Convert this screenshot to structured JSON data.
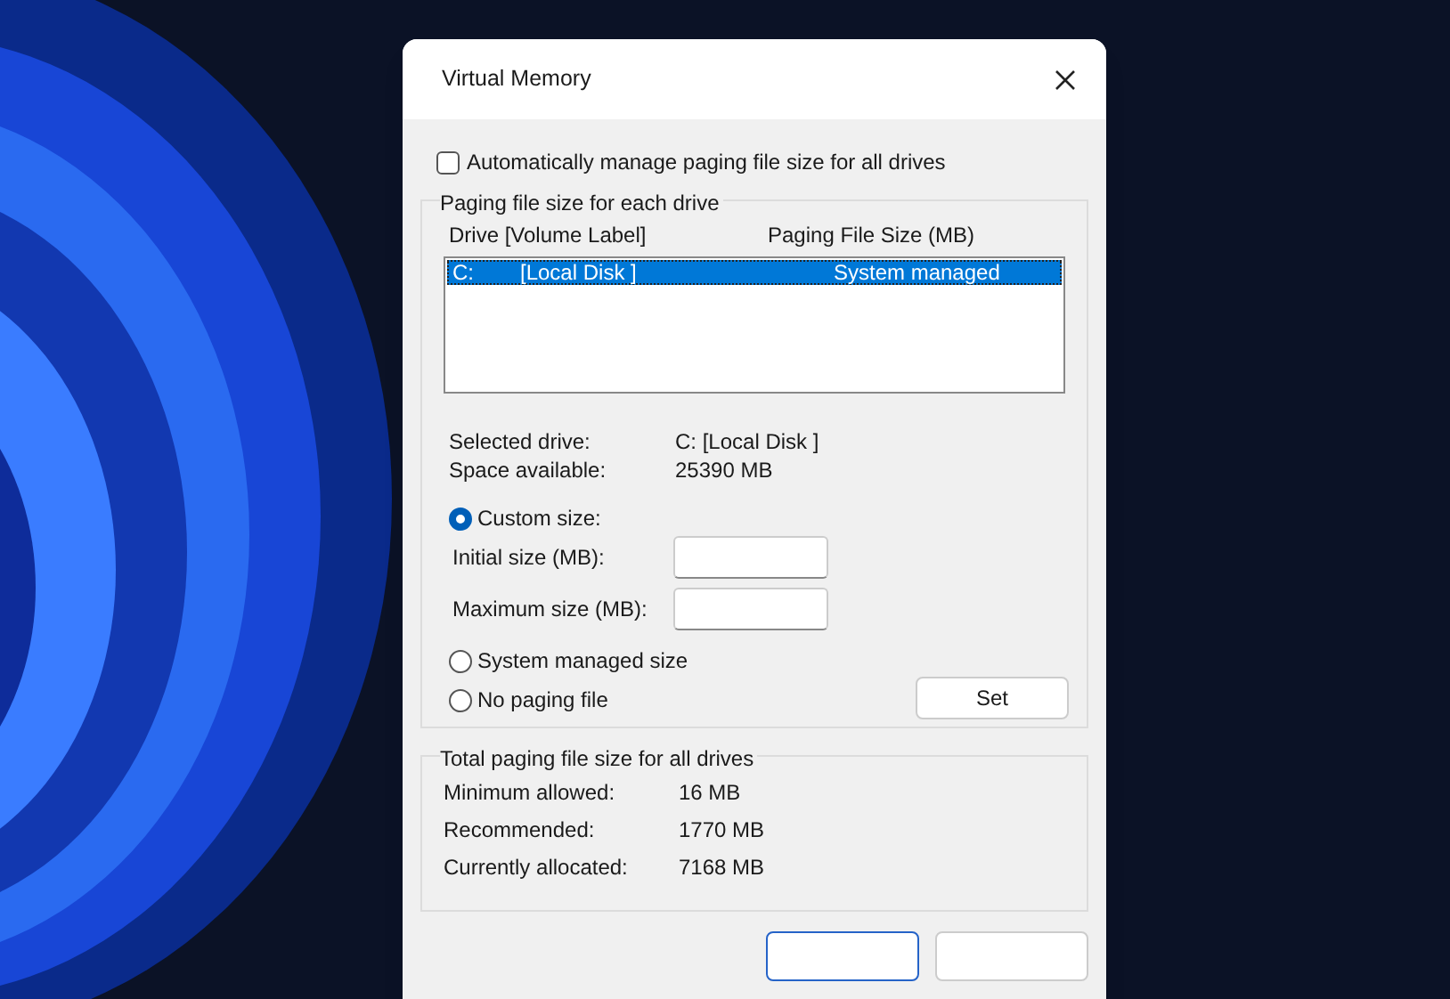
{
  "window": {
    "title": "Virtual Memory"
  },
  "auto_manage": {
    "label": "Automatically manage paging file size for all drives",
    "checked": false
  },
  "drive_group": {
    "title": "Paging file size for each drive",
    "columns": [
      "Drive  [Volume Label]",
      "Paging File Size (MB)"
    ],
    "rows": [
      {
        "drive": "C:",
        "volume": "[Local Disk ]",
        "size": "System managed",
        "selected": true
      }
    ],
    "selected_drive": {
      "label": "Selected drive:",
      "value": "C:  [Local Disk ]"
    },
    "space_available": {
      "label": "Space available:",
      "value": "25390 MB"
    },
    "options": [
      {
        "kind": "custom",
        "label": "Custom size:",
        "selected": true
      },
      {
        "kind": "system",
        "label": "System managed size",
        "selected": false
      },
      {
        "kind": "none",
        "label": "No paging file",
        "selected": false
      }
    ],
    "fields": [
      {
        "label": "Initial size (MB):"
      },
      {
        "label": "Maximum size (MB):"
      }
    ],
    "set_button": "Set"
  },
  "totals": {
    "title": "Total paging file size for all drives",
    "rows": [
      {
        "label": "Minimum allowed:",
        "value": "16 MB"
      },
      {
        "label": "Recommended:",
        "value": "1770 MB"
      },
      {
        "label": "Currently allocated:",
        "value": "7168 MB"
      }
    ]
  }
}
